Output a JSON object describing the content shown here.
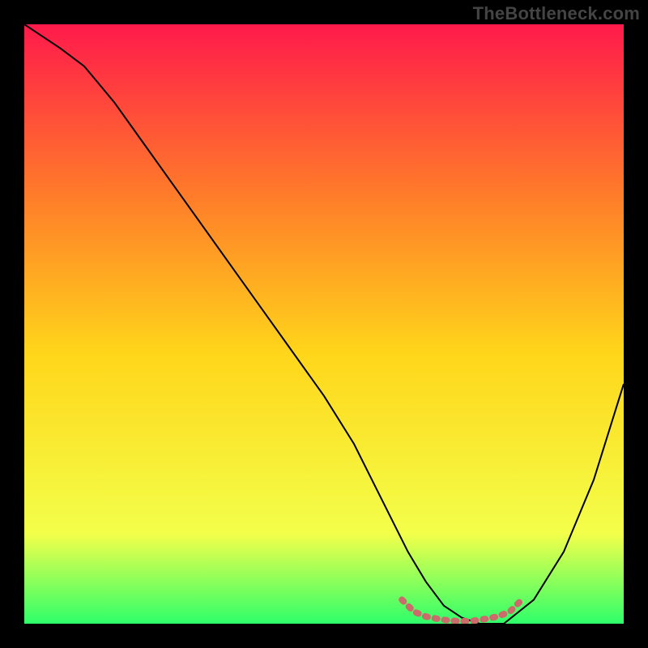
{
  "attribution": "TheBottleneck.com",
  "chart_data": {
    "type": "line",
    "title": "",
    "xlabel": "",
    "ylabel": "",
    "xlim": [
      0,
      100
    ],
    "ylim": [
      0,
      100
    ],
    "background_gradient": {
      "top": "#ff1a4b",
      "upper_mid": "#ff7a2a",
      "mid": "#ffd61a",
      "lower_mid": "#f3ff4a",
      "bottom": "#2eff6a"
    },
    "series": [
      {
        "name": "bottleneck-curve",
        "stroke": "#000000",
        "stroke_width": 2,
        "x": [
          0,
          3,
          6,
          10,
          15,
          20,
          25,
          30,
          35,
          40,
          45,
          50,
          55,
          58,
          61,
          64,
          67,
          70,
          73,
          76,
          80,
          85,
          90,
          95,
          100
        ],
        "y": [
          100,
          98,
          96,
          93,
          87,
          80,
          73,
          66,
          59,
          52,
          45,
          38,
          30,
          24,
          18,
          12,
          7,
          3,
          1,
          0,
          0,
          4,
          12,
          24,
          40
        ]
      },
      {
        "name": "optimal-band-marker",
        "stroke": "#cc6b6b",
        "stroke_width": 8,
        "x": [
          63,
          65,
          67,
          69,
          71,
          73,
          75,
          77,
          79,
          81,
          83
        ],
        "y": [
          4,
          2,
          1.2,
          0.8,
          0.5,
          0.4,
          0.5,
          0.8,
          1.2,
          2,
          4
        ]
      }
    ]
  }
}
